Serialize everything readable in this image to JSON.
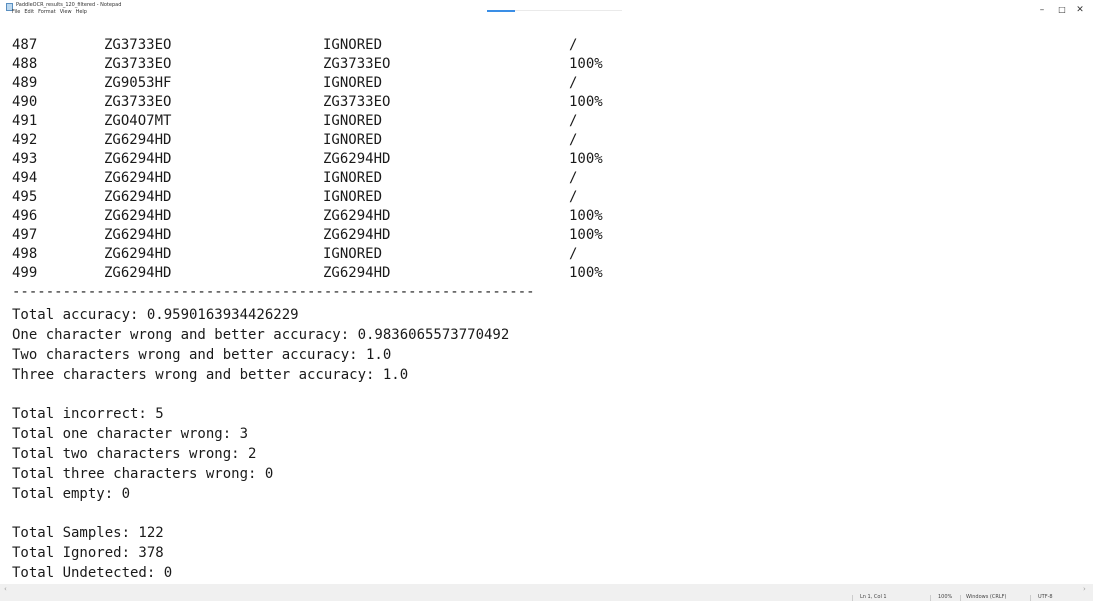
{
  "window": {
    "title": "PaddleOCR_results_120_filtered - Notepad",
    "controls": {
      "minimize": "–",
      "maximize": "□",
      "close": "✕"
    }
  },
  "menu": [
    "File",
    "Edit",
    "Format",
    "View",
    "Help"
  ],
  "table": {
    "rows": [
      {
        "index": "487",
        "label": "ZG3733EO",
        "prediction": "IGNORED",
        "score": "/"
      },
      {
        "index": "488",
        "label": "ZG3733EO",
        "prediction": "ZG3733EO",
        "score": "100%"
      },
      {
        "index": "489",
        "label": "ZG9053HF",
        "prediction": "IGNORED",
        "score": "/"
      },
      {
        "index": "490",
        "label": "ZG3733EO",
        "prediction": "ZG3733EO",
        "score": "100%"
      },
      {
        "index": "491",
        "label": "ZGO4O7MT",
        "prediction": "IGNORED",
        "score": "/"
      },
      {
        "index": "492",
        "label": "ZG6294HD",
        "prediction": "IGNORED",
        "score": "/"
      },
      {
        "index": "493",
        "label": "ZG6294HD",
        "prediction": "ZG6294HD",
        "score": "100%"
      },
      {
        "index": "494",
        "label": "ZG6294HD",
        "prediction": "IGNORED",
        "score": "/"
      },
      {
        "index": "495",
        "label": "ZG6294HD",
        "prediction": "IGNORED",
        "score": "/"
      },
      {
        "index": "496",
        "label": "ZG6294HD",
        "prediction": "ZG6294HD",
        "score": "100%"
      },
      {
        "index": "497",
        "label": "ZG6294HD",
        "prediction": "ZG6294HD",
        "score": "100%"
      },
      {
        "index": "498",
        "label": "ZG6294HD",
        "prediction": "IGNORED",
        "score": "/"
      },
      {
        "index": "499",
        "label": "ZG6294HD",
        "prediction": "ZG6294HD",
        "score": "100%"
      }
    ],
    "separator": "--------------------------------------------------------------"
  },
  "summary": {
    "total_accuracy": "Total accuracy: 0.9590163934426229",
    "one_char_accuracy": "One character wrong and better accuracy: 0.9836065573770492",
    "two_char_accuracy": "Two characters wrong and better accuracy: 1.0",
    "three_char_accuracy": "Three characters wrong and better accuracy: 1.0",
    "total_incorrect": "Total incorrect: 5",
    "total_one_wrong": "Total one character wrong: 3",
    "total_two_wrong": "Total two characters wrong: 2",
    "total_three_wrong": "Total three characters wrong: 0",
    "total_empty": "Total empty: 0",
    "total_samples": "Total Samples: 122",
    "total_ignored": "Total Ignored: 378",
    "total_undetected": "Total Undetected: 0"
  },
  "status_bar": {
    "position": "Ln 1, Col 1",
    "zoom": "100%",
    "line_ending": "Windows (CRLF)",
    "encoding": "UTF-8"
  }
}
